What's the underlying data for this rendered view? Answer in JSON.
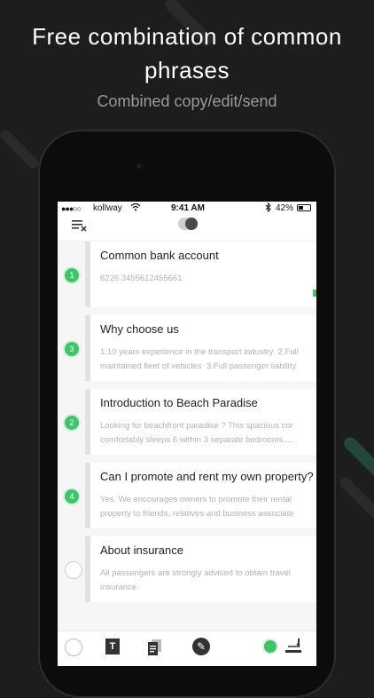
{
  "headline": "Free combination of common phrases",
  "subhead": "Combined copy/edit/send",
  "status": {
    "carrier": "kollway",
    "time": "9:41 AM",
    "battery": "42%",
    "battery_level": 0.42
  },
  "items": [
    {
      "num": "1",
      "title": "Common bank account",
      "body": "6226 3455612455661",
      "selected": true
    },
    {
      "num": "3",
      "title": "Why choose us",
      "body": "1.10 years experience in the transport industry  2.Full\nmaintained fleet of vehicles  3.Full passenger liability",
      "selected": true
    },
    {
      "num": "2",
      "title": "Introduction to Beach Paradise",
      "body": "Looking for beachfront paradise ? This spacious cor\ncomfortably sleeps 6 within 3 separate bedrooms....",
      "selected": true
    },
    {
      "num": "4",
      "title": "Can I promote and rent my own property?",
      "body": "Yes. We encourages owners to promote their rental\nproperty to friends, relatives and business associate",
      "selected": true
    },
    {
      "num": "",
      "title": "About insurance",
      "body": "All passengers are strongly advised to obtain travel\ninsurance.",
      "selected": false
    }
  ],
  "icons": {
    "menu": "list-close-icon",
    "text": "text-icon",
    "copy": "copy-icon",
    "edit": "pencil-icon",
    "send": "send-icon"
  },
  "accent": "#3fc46a",
  "bottom": {
    "text_label": "T"
  }
}
